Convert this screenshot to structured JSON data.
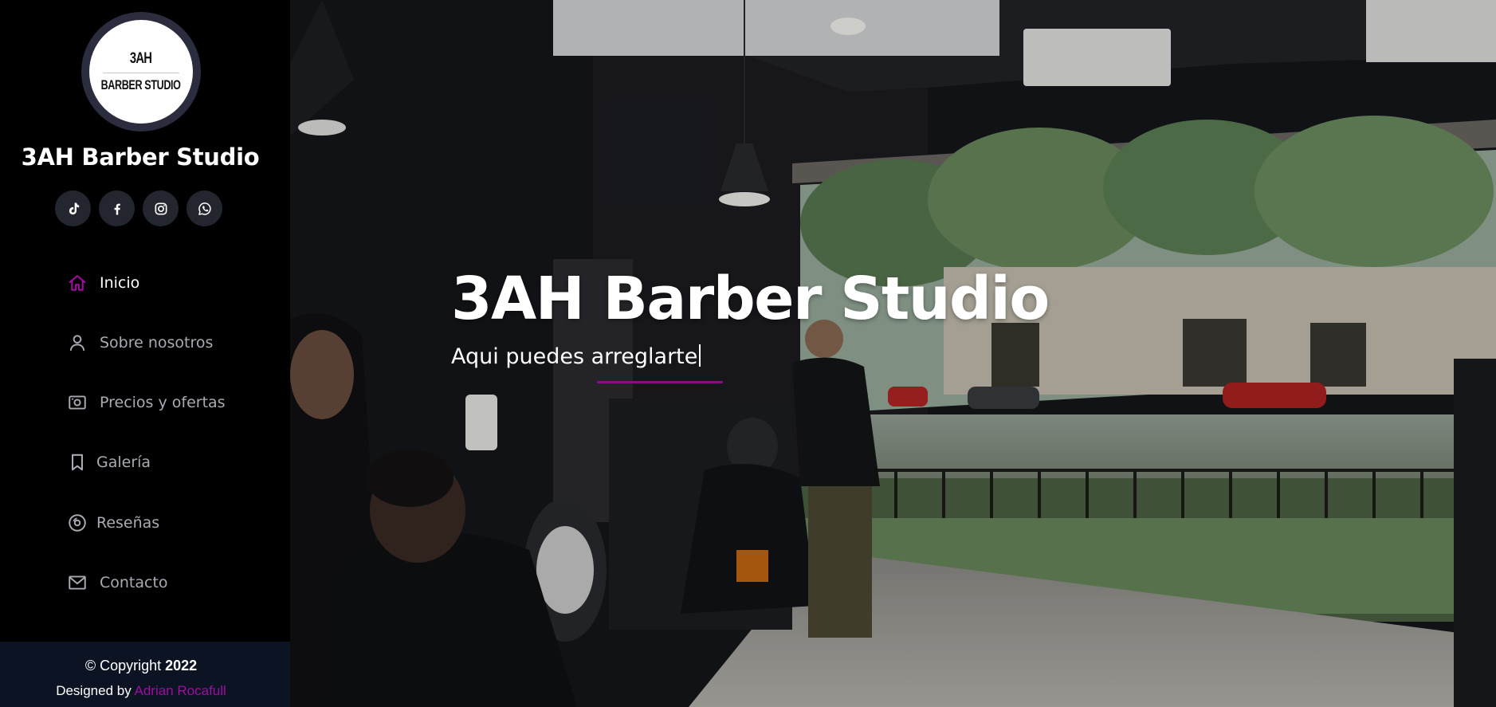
{
  "brand": {
    "name": "3AH Barber Studio",
    "logo_line1": "3AH",
    "logo_line2": "BARBER STUDIO"
  },
  "social": [
    {
      "name": "tiktok",
      "icon": "tiktok-icon"
    },
    {
      "name": "facebook",
      "icon": "facebook-icon"
    },
    {
      "name": "instagram",
      "icon": "instagram-icon"
    },
    {
      "name": "whatsapp",
      "icon": "whatsapp-icon"
    }
  ],
  "nav": {
    "active_index": 0,
    "items": [
      {
        "label": "Inicio",
        "icon": "home-icon"
      },
      {
        "label": "Sobre nosotros",
        "icon": "user-icon"
      },
      {
        "label": "Precios y ofertas",
        "icon": "camera-icon"
      },
      {
        "label": "Galería",
        "icon": "bookmark-icon"
      },
      {
        "label": "Reseñas",
        "icon": "disc-icon"
      },
      {
        "label": "Contacto",
        "icon": "envelope-icon"
      }
    ]
  },
  "footer": {
    "copyright_prefix": "© Copyright",
    "copyright_year": "2022",
    "designed_prefix": "Designed by",
    "designer": "Adrian Rocafull"
  },
  "hero": {
    "title": "3AH Barber Studio",
    "subtitle": "Aqui puedes arreglarte"
  },
  "colors": {
    "accent": "#a00ca0",
    "sidebar_bg": "#000000",
    "footer_bg": "#0c1424",
    "social_bg": "#23252f"
  }
}
